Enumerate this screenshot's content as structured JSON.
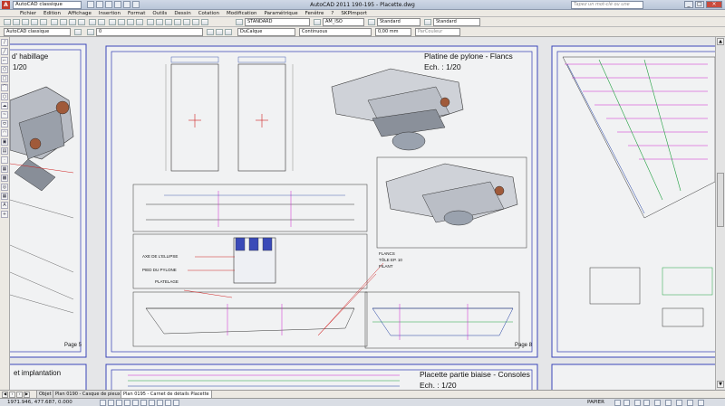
{
  "titlebar": {
    "workspace": "AutoCAD classique",
    "title": "AutoCAD 2011   190-195 - Placette.dwg",
    "search_placeholder": "Tapez un mot-clé ou une expressio"
  },
  "menu": [
    "Fichier",
    "Edition",
    "Affichage",
    "Insertion",
    "Format",
    "Outils",
    "Dessin",
    "Cotation",
    "Modification",
    "Paramétrique",
    "Fenêtre",
    "?",
    "SKPImport"
  ],
  "toolbar1": {
    "textstyle": "STANDARD",
    "dimstyle": "AM_ISO",
    "tablestyle": "Standard",
    "mleaderstyle": "Standard"
  },
  "toolbar2": {
    "workspace": "AutoCAD classique",
    "layer": "0",
    "color": "DuCalque",
    "linetype": "Continuous",
    "lineweight": "0,00 mm",
    "plotstyle": "ParCouleur"
  },
  "sheets": {
    "left_top_title_1": "d' habillage",
    "left_top_title_2": "1/20",
    "left_page": "Page 5",
    "left_bottom_title": "et implantation",
    "main_title_1": "Platine de pylone - Flancs",
    "main_title_2": "Ech. : 1/20",
    "main_page": "Page 8",
    "bottom_title_1": "Placette partie biaise - Consoles",
    "bottom_title_2": "Ech. : 1/20",
    "annot_axe": "AXE DE L'ELLIPSE",
    "annot_pied": "PIED DU PYLONE",
    "annot_platelage": "PLATELAGE",
    "annot_flancs": "FLANCS",
    "annot_tole": "TÔLE EP. 10",
    "annot_filant": "FILANT"
  },
  "tabs": [
    "Objet",
    "Plan 0190 - Casque de pieux type 3",
    "Plan 0195 - Carnet de détails Placette"
  ],
  "status": {
    "coords": "1971.946, 477.687, 0.000",
    "paper": "PAPIER"
  },
  "colors": {
    "sheet_border": "#3a45b8",
    "accent_red": "#e02020",
    "accent_magenta": "#d020d0",
    "accent_green": "#20a040"
  }
}
